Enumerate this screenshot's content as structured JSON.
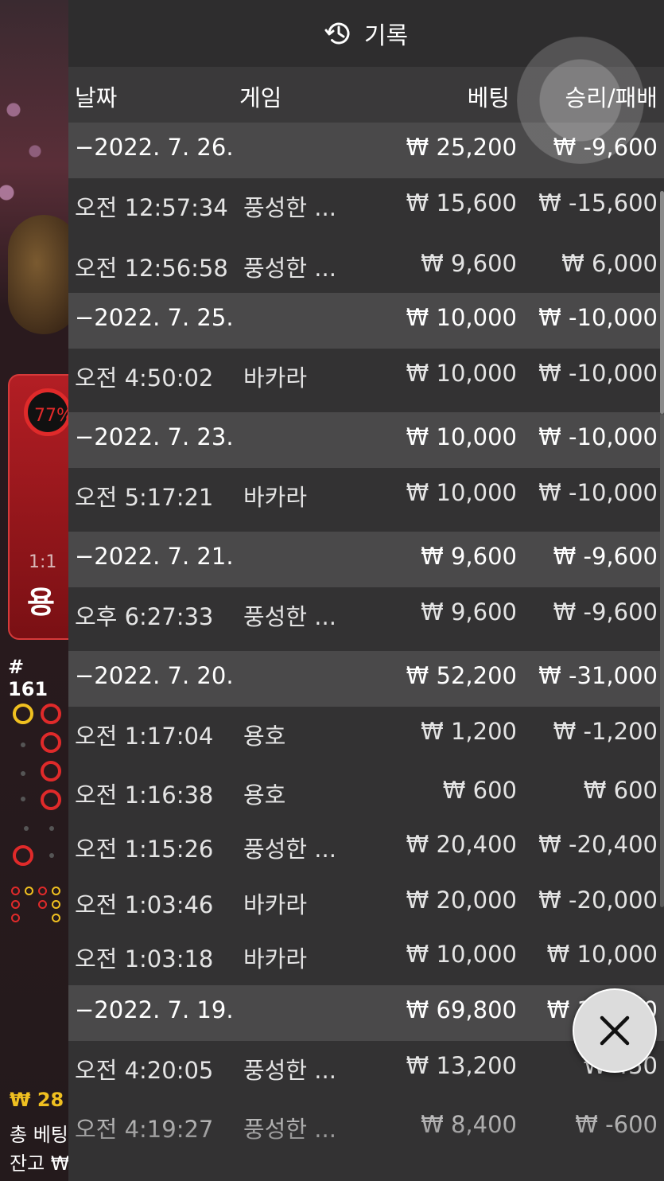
{
  "header": {
    "title": "기록",
    "icon": "history-icon"
  },
  "columns": {
    "date": "날짜",
    "game": "게임",
    "bet": "베팅",
    "result": "승리/패배"
  },
  "rows": [
    {
      "type": "date",
      "time": "−2022. 7. 26.",
      "game": "",
      "bet": "₩ 25,200",
      "result": "₩ -9,600"
    },
    {
      "type": "item",
      "time": "오전 12:57:34",
      "game": "풍성한 ...",
      "bet": "₩ 15,600",
      "result": "₩ -15,600"
    },
    {
      "type": "item",
      "time": "오전 12:56:58",
      "game": "풍성한 ...",
      "bet": "₩ 9,600",
      "result": "₩ 6,000"
    },
    {
      "type": "date",
      "time": "−2022. 7. 25.",
      "game": "",
      "bet": "₩ 10,000",
      "result": "₩ -10,000"
    },
    {
      "type": "item",
      "time": "오전 4:50:02",
      "game": "바카라",
      "bet": "₩ 10,000",
      "result": "₩ -10,000"
    },
    {
      "type": "date",
      "time": "−2022. 7. 23.",
      "game": "",
      "bet": "₩ 10,000",
      "result": "₩ -10,000"
    },
    {
      "type": "item",
      "time": "오전 5:17:21",
      "game": "바카라",
      "bet": "₩ 10,000",
      "result": "₩ -10,000"
    },
    {
      "type": "date",
      "time": "−2022. 7. 21.",
      "game": "",
      "bet": "₩ 9,600",
      "result": "₩ -9,600"
    },
    {
      "type": "item",
      "time": "오후 6:27:33",
      "game": "풍성한 ...",
      "bet": "₩ 9,600",
      "result": "₩ -9,600"
    },
    {
      "type": "date",
      "time": "−2022. 7. 20.",
      "game": "",
      "bet": "₩ 52,200",
      "result": "₩ -31,000"
    },
    {
      "type": "item",
      "time": "오전 1:17:04",
      "game": "용호",
      "bet": "₩ 1,200",
      "result": "₩ -1,200"
    },
    {
      "type": "item",
      "time": "오전 1:16:38",
      "game": "용호",
      "bet": "₩ 600",
      "result": "₩ 600"
    },
    {
      "type": "item",
      "time": "오전 1:15:26",
      "game": "풍성한 ...",
      "bet": "₩ 20,400",
      "result": "₩ -20,400"
    },
    {
      "type": "item",
      "time": "오전 1:03:46",
      "game": "바카라",
      "bet": "₩ 20,000",
      "result": "₩ -20,000"
    },
    {
      "type": "item",
      "time": "오전 1:03:18",
      "game": "바카라",
      "bet": "₩ 10,000",
      "result": "₩ 10,000"
    },
    {
      "type": "date",
      "time": "−2022. 7. 19.",
      "game": "",
      "bet": "₩ 69,800",
      "result": "₩ 19,000"
    },
    {
      "type": "item",
      "time": "오전 4:20:05",
      "game": "풍성한 ...",
      "bet": "₩ 13,200",
      "result": "₩ 450"
    },
    {
      "type": "item",
      "time": "오전 4:19:27",
      "game": "풍성한 ...",
      "bet": "₩ 8,400",
      "result": "₩ -600"
    }
  ],
  "background_game": {
    "win_percent": "77%",
    "odds": "1:1",
    "dragon_label": "용",
    "round": "# 161",
    "balance_gold": "₩ 28",
    "total_bet_label": "총 베팅",
    "balance_label": "잔고 ₩"
  },
  "close_button": {
    "icon": "close-icon"
  },
  "colors": {
    "panel": "#333233",
    "date_row": "#4a494a",
    "accent_red": "#e02a2a",
    "accent_gold": "#f0c020"
  }
}
